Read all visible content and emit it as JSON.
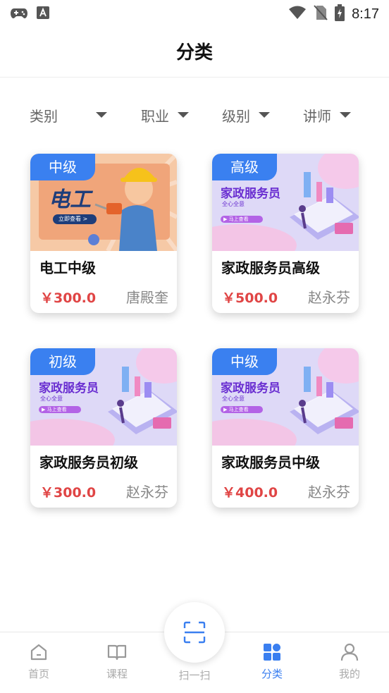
{
  "status_bar": {
    "time": "8:17",
    "icons": [
      "gamepad-icon",
      "font-icon",
      "wifi-icon",
      "no-sim-icon",
      "battery-charging-icon"
    ]
  },
  "header": {
    "title": "分类"
  },
  "filters": [
    {
      "label": "类别"
    },
    {
      "label": "职业"
    },
    {
      "label": "级别"
    },
    {
      "label": "讲师"
    }
  ],
  "courses": [
    {
      "level": "中级",
      "banner_text": "电工",
      "banner_sub": "立即查看 >",
      "title": "电工中级",
      "price": "￥300.0",
      "teacher": "唐殿奎"
    },
    {
      "level": "高级",
      "banner_text": "家政服务员",
      "banner_sub": "全心全意",
      "banner_btn": "▶ 马上查看",
      "title": "家政服务员高级",
      "price": "￥500.0",
      "teacher": "赵永芬"
    },
    {
      "level": "初级",
      "banner_text": "家政服务员",
      "banner_sub": "全心全意",
      "banner_btn": "▶ 马上查看",
      "title": "家政服务员初级",
      "price": "￥300.0",
      "teacher": "赵永芬"
    },
    {
      "level": "中级",
      "banner_text": "家政服务员",
      "banner_sub": "全心全意",
      "banner_btn": "▶ 马上查看",
      "title": "家政服务员中级",
      "price": "￥400.0",
      "teacher": "赵永芬"
    }
  ],
  "bottom_nav": {
    "items": [
      {
        "label": "首页",
        "icon": "home-icon"
      },
      {
        "label": "课程",
        "icon": "book-icon"
      },
      {
        "label": "扫一扫",
        "icon": "scan-icon"
      },
      {
        "label": "分类",
        "icon": "category-icon",
        "active": true
      },
      {
        "label": "我的",
        "icon": "user-icon"
      }
    ]
  },
  "colors": {
    "accent": "#3a7ff0",
    "price": "#e04545",
    "badge": "#3a80f0"
  }
}
